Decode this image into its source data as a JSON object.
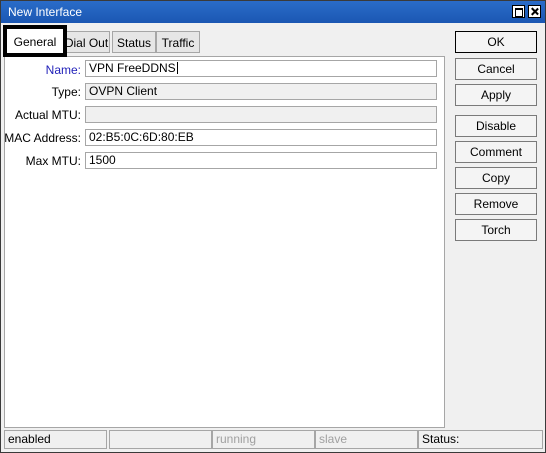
{
  "window": {
    "title": "New Interface"
  },
  "tabs": [
    {
      "label": "General"
    },
    {
      "label": "Dial Out"
    },
    {
      "label": "Status"
    },
    {
      "label": "Traffic"
    }
  ],
  "fields": {
    "name": {
      "label": "Name:",
      "value": "VPN FreeDDNS"
    },
    "type": {
      "label": "Type:",
      "value": "OVPN Client"
    },
    "actual_mtu": {
      "label": "Actual MTU:",
      "value": ""
    },
    "mac_address": {
      "label": "MAC Address:",
      "value": "02:B5:0C:6D:80:EB"
    },
    "max_mtu": {
      "label": "Max MTU:",
      "value": "1500"
    }
  },
  "buttons": {
    "ok": "OK",
    "cancel": "Cancel",
    "apply": "Apply",
    "disable": "Disable",
    "comment": "Comment",
    "copy": "Copy",
    "remove": "Remove",
    "torch": "Torch"
  },
  "statusbar": {
    "state": "enabled",
    "empty": "",
    "running": "running",
    "slave": "slave",
    "status": "Status:"
  },
  "colors": {
    "titlebar": "#1b57b3",
    "name_label": "#1f1fb8"
  }
}
